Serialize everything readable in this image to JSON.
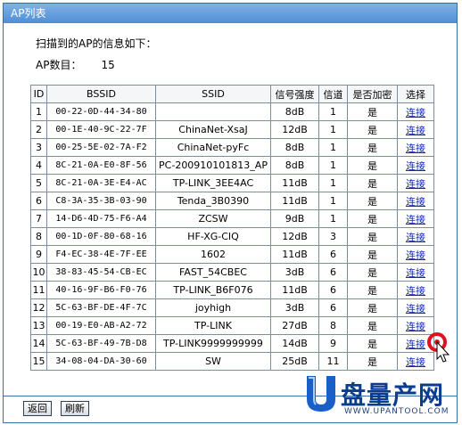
{
  "window": {
    "title": "AP列表"
  },
  "intro_text": "扫描到的AP的信息如下：",
  "ap_count": {
    "label": "AP数目：",
    "value": "15"
  },
  "table": {
    "headers": [
      "ID",
      "BSSID",
      "SSID",
      "信号强度",
      "信道",
      "是否加密",
      "选择"
    ],
    "rows": [
      {
        "id": "1",
        "bssid": "00-22-0D-44-34-80",
        "ssid": "",
        "signal": "8dB",
        "channel": "1",
        "encrypted": "是",
        "action": "连接"
      },
      {
        "id": "2",
        "bssid": "00-1E-40-9C-22-7F",
        "ssid": "ChinaNet-XsaJ",
        "signal": "12dB",
        "channel": "1",
        "encrypted": "是",
        "action": "连接"
      },
      {
        "id": "3",
        "bssid": "00-25-5E-02-7A-F2",
        "ssid": "ChinaNet-pyFc",
        "signal": "8dB",
        "channel": "1",
        "encrypted": "是",
        "action": "连接"
      },
      {
        "id": "4",
        "bssid": "8C-21-0A-E0-8F-56",
        "ssid": "PC-200910101813_AP",
        "signal": "8dB",
        "channel": "1",
        "encrypted": "是",
        "action": "连接"
      },
      {
        "id": "5",
        "bssid": "8C-21-0A-3E-E4-AC",
        "ssid": "TP-LINK_3EE4AC",
        "signal": "11dB",
        "channel": "1",
        "encrypted": "是",
        "action": "连接"
      },
      {
        "id": "6",
        "bssid": "C8-3A-35-3B-03-90",
        "ssid": "Tenda_3B0390",
        "signal": "11dB",
        "channel": "1",
        "encrypted": "是",
        "action": "连接"
      },
      {
        "id": "7",
        "bssid": "14-D6-4D-75-F6-A4",
        "ssid": "ZCSW",
        "signal": "9dB",
        "channel": "1",
        "encrypted": "是",
        "action": "连接"
      },
      {
        "id": "8",
        "bssid": "00-1D-0F-80-68-16",
        "ssid": "HF-XG-CIQ",
        "signal": "12dB",
        "channel": "3",
        "encrypted": "是",
        "action": "连接"
      },
      {
        "id": "9",
        "bssid": "F4-EC-38-4E-7F-EE",
        "ssid": "1602",
        "signal": "11dB",
        "channel": "6",
        "encrypted": "是",
        "action": "连接"
      },
      {
        "id": "10",
        "bssid": "38-83-45-54-CB-EC",
        "ssid": "FAST_54CBEC",
        "signal": "3dB",
        "channel": "6",
        "encrypted": "是",
        "action": "连接"
      },
      {
        "id": "11",
        "bssid": "40-16-9F-B6-F0-76",
        "ssid": "TP-LINK_B6F076",
        "signal": "11dB",
        "channel": "6",
        "encrypted": "是",
        "action": "连接"
      },
      {
        "id": "12",
        "bssid": "5C-63-BF-DE-4F-7C",
        "ssid": "joyhigh",
        "signal": "3dB",
        "channel": "6",
        "encrypted": "是",
        "action": "连接"
      },
      {
        "id": "13",
        "bssid": "00-19-E0-AB-A2-72",
        "ssid": "TP-LINK",
        "signal": "27dB",
        "channel": "8",
        "encrypted": "是",
        "action": "连接"
      },
      {
        "id": "14",
        "bssid": "5C-63-BF-49-7B-D8",
        "ssid": "TP-LINK9999999999",
        "signal": "14dB",
        "channel": "9",
        "encrypted": "是",
        "action": "连接"
      },
      {
        "id": "15",
        "bssid": "34-08-04-DA-30-60",
        "ssid": "SW",
        "signal": "25dB",
        "channel": "11",
        "encrypted": "是",
        "action": "连接"
      }
    ]
  },
  "buttons": {
    "back": "返回",
    "refresh": "刷新"
  },
  "watermark": {
    "main": "盘量产网",
    "sub": "WWW.UPANTOOL.COM"
  },
  "colors": {
    "titlebar": "#4f8fd6",
    "border": "#3a6ea5",
    "link": "#0b2db5",
    "cursor_ring": "#e01020"
  }
}
